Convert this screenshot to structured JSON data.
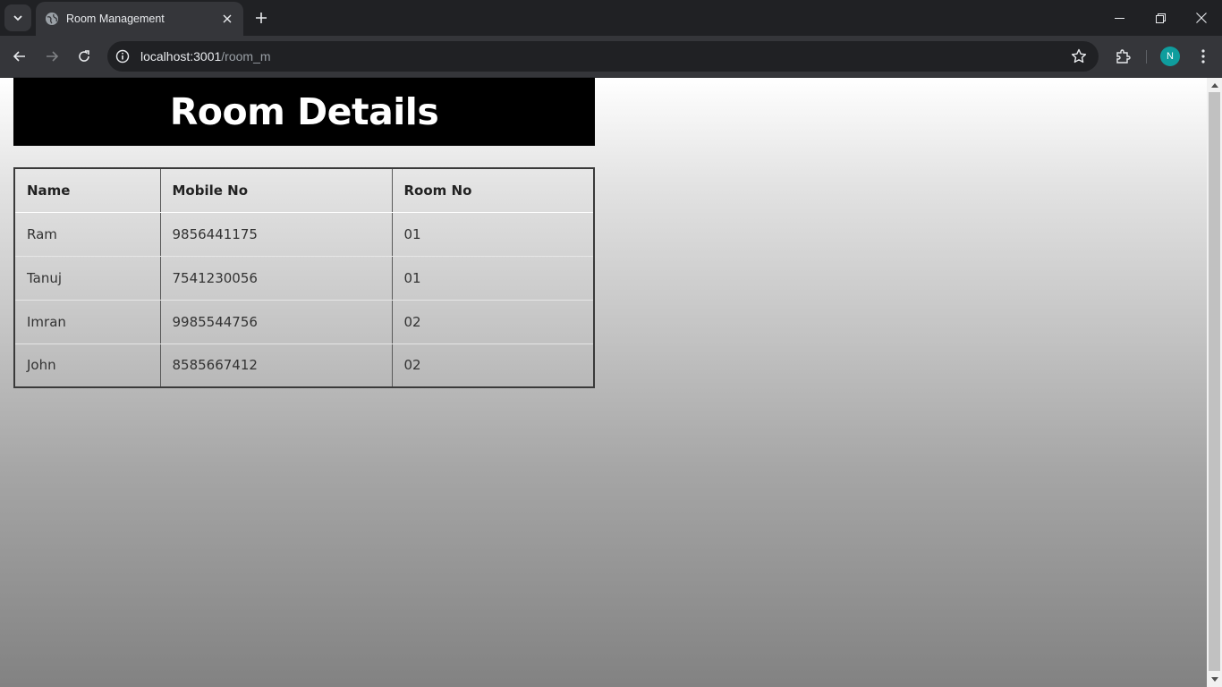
{
  "browser": {
    "tab": {
      "title": "Room Management"
    },
    "url": {
      "host": "localhost:3001",
      "path": "/room_m"
    },
    "profile_initial": "N",
    "icons": [
      "tab-search-icon",
      "globe-icon",
      "close-icon",
      "plus-icon",
      "minimize-icon",
      "restore-icon",
      "window-close-icon",
      "back-arrow-icon",
      "forward-arrow-icon",
      "reload-icon",
      "site-info-icon",
      "star-icon",
      "puzzle-icon",
      "kebab-menu-icon"
    ]
  },
  "page": {
    "title": "Room Details",
    "table": {
      "headers": [
        "Name",
        "Mobile No",
        "Room No"
      ],
      "rows": [
        [
          "Ram",
          "9856441175",
          "01"
        ],
        [
          "Tanuj",
          "7541230056",
          "01"
        ],
        [
          "Imran",
          "9985544756",
          "02"
        ],
        [
          "John",
          "8585667412",
          "02"
        ]
      ]
    }
  }
}
